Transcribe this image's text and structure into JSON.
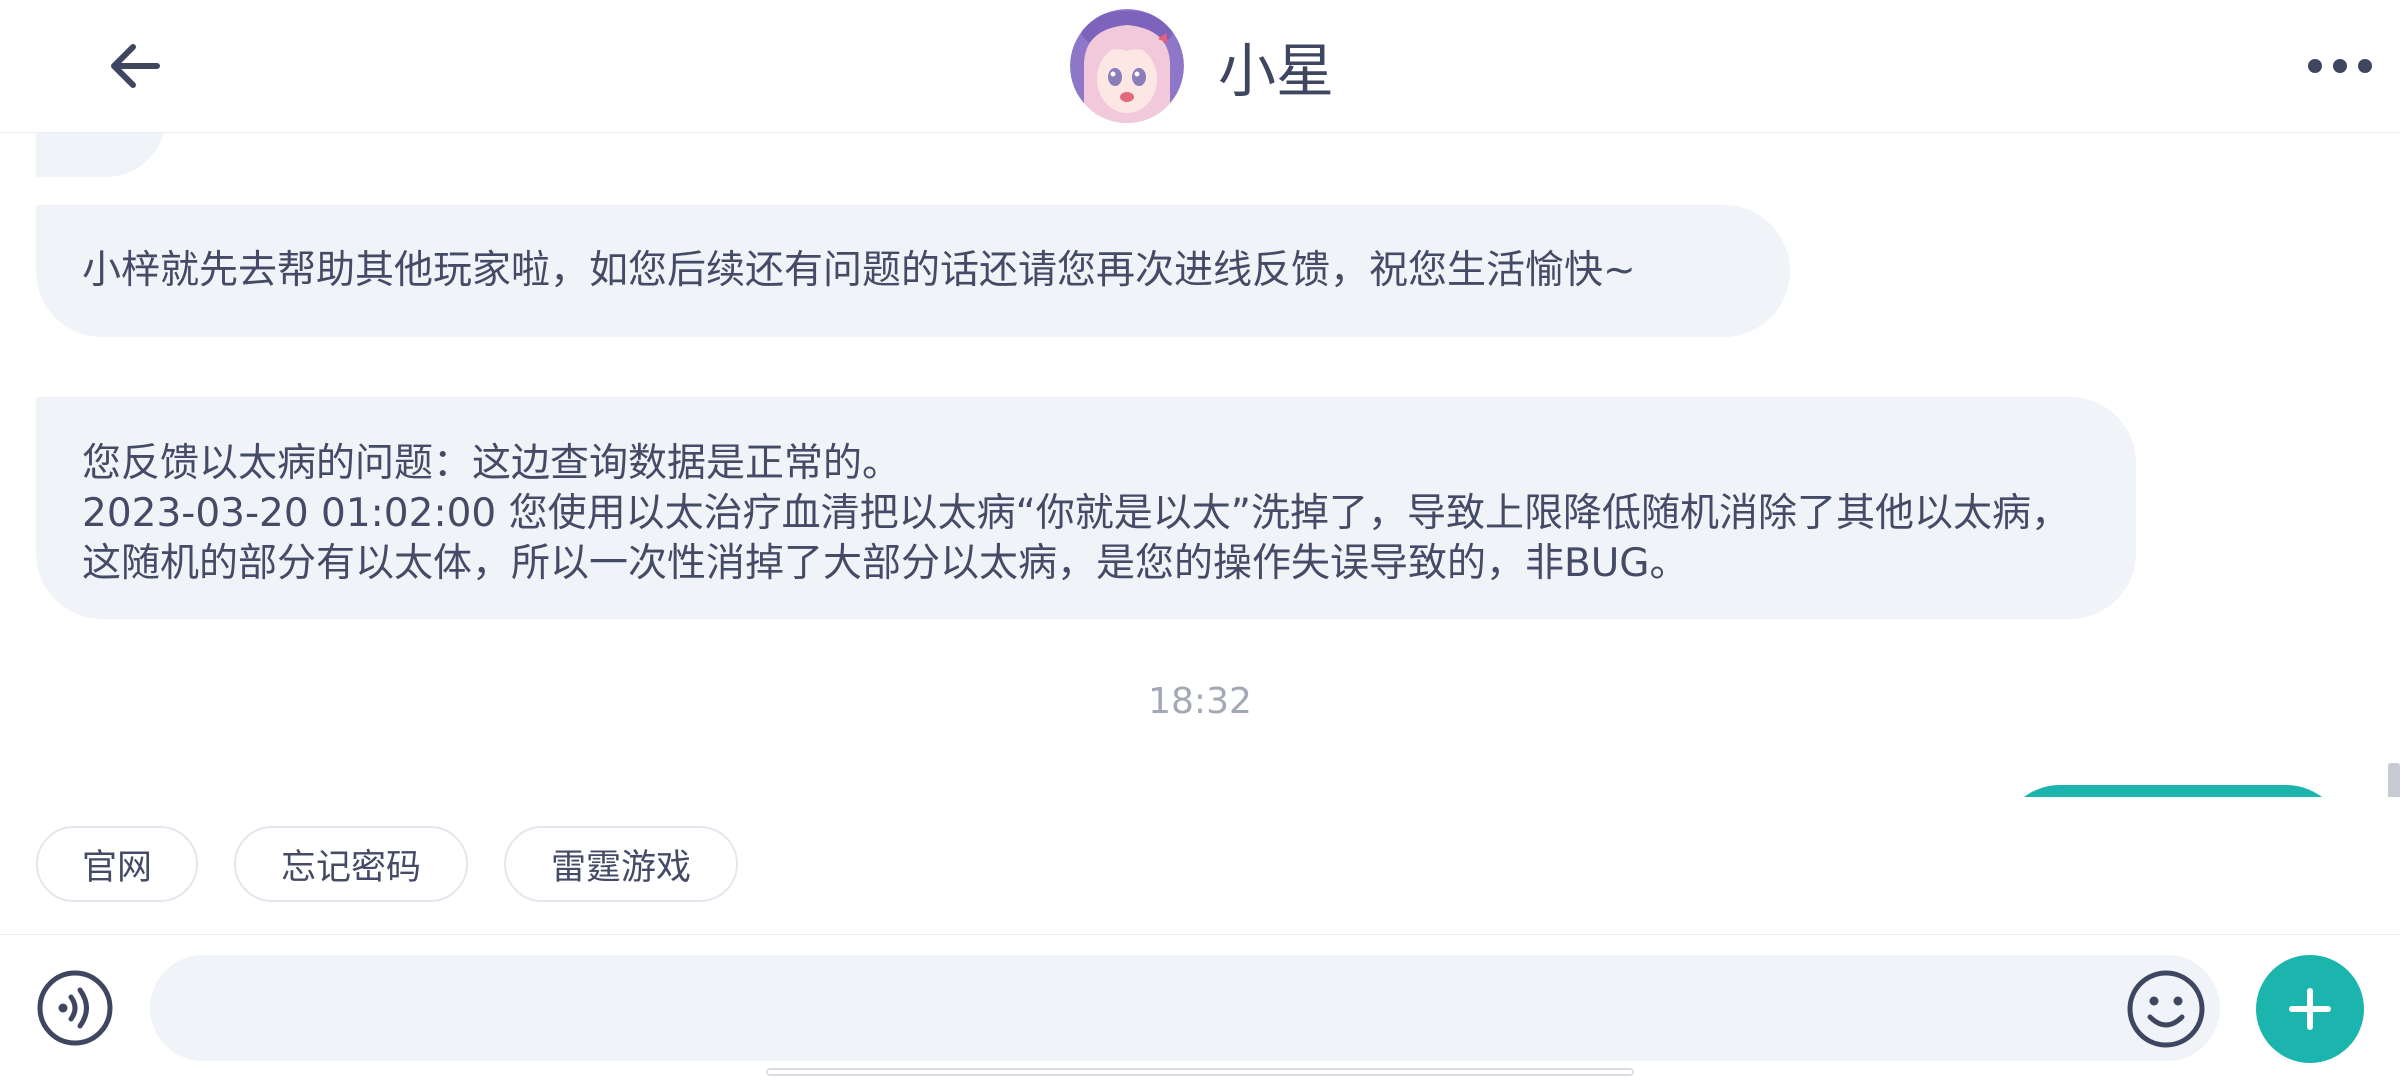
{
  "header": {
    "title": "小星",
    "back_icon": "arrow-left-icon",
    "more_icon": "more-horizontal-icon",
    "avatar": "anime-girl-avatar"
  },
  "messages": [
    {
      "role": "agent",
      "text": "小梓就先去帮助其他玩家啦，如您后续还有问题的话还请您再次进线反馈，祝您生活愉快~"
    },
    {
      "role": "agent",
      "text": "您反馈以太病的问题：这边查询数据是正常的。\n2023-03-20 01:02:00 您使用以太治疗血清把以太病“你就是以太”洗掉了，导致上限降低随机消除了其他以太病，这随机的部分有以太体，所以一次性消掉了大部分以太病，是您的操作失误导致的，非BUG。"
    }
  ],
  "timestamp": "18:32",
  "quick_replies": [
    "官网",
    "忘记密码",
    "雷霆游戏"
  ],
  "input": {
    "value": "",
    "placeholder": "",
    "voice_icon": "voice-icon",
    "emoji_icon": "emoji-icon",
    "plus_icon": "plus-icon"
  },
  "colors": {
    "accent": "#1cb5ad",
    "bubble_bg": "#f0f3f7",
    "text": "#454b66",
    "muted": "#a3a8b6"
  }
}
